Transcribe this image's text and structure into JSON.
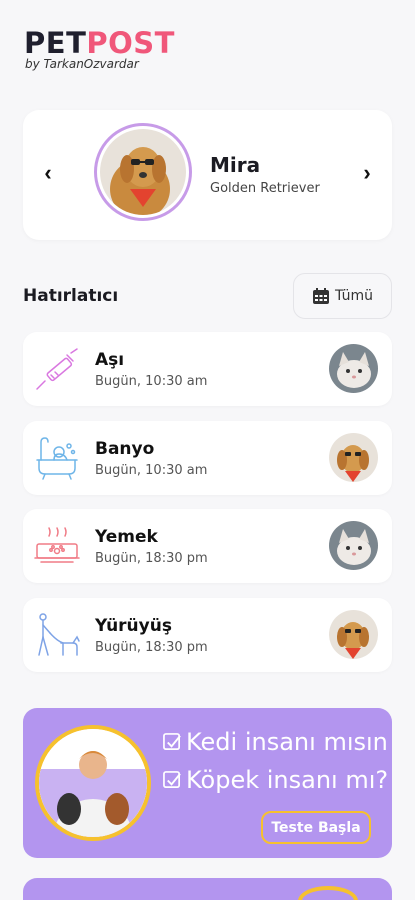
{
  "logo": {
    "part1": "PET",
    "part2": "POST",
    "subtitle": "by TarkanOzvardar"
  },
  "pet": {
    "name": "Mira",
    "breed": "Golden Retriever",
    "prev_icon": "chevron-left-icon",
    "next_icon": "chevron-right-icon"
  },
  "reminders_section": {
    "title": "Hatırlatıcı",
    "filter_label": "Tümü",
    "filter_icon": "calendar-icon"
  },
  "reminders": [
    {
      "title": "Aşı",
      "time": "Bugün, 10:30 am",
      "icon": "syringe-icon",
      "icon_color": "#d978e0",
      "avatar": "cat"
    },
    {
      "title": "Banyo",
      "time": "Bugün, 10:30 am",
      "icon": "bathtub-icon",
      "icon_color": "#6fb5e8",
      "avatar": "dog"
    },
    {
      "title": "Yemek",
      "time": "Bugün, 18:30 pm",
      "icon": "food-bowl-icon",
      "icon_color": "#f07b86",
      "avatar": "cat"
    },
    {
      "title": "Yürüyüş",
      "time": "Bugün, 18:30 pm",
      "icon": "dog-walk-icon",
      "icon_color": "#7ea3e6",
      "avatar": "dog"
    }
  ],
  "promo": {
    "line1": "Kedi insanı mısın",
    "line2": "Köpek insanı mı?",
    "button": "Teste Başla",
    "background": "#b395ef",
    "accent": "#f6c12e"
  },
  "colors": {
    "brand_pink": "#f0577a",
    "avatar_ring": "#c79be8"
  }
}
